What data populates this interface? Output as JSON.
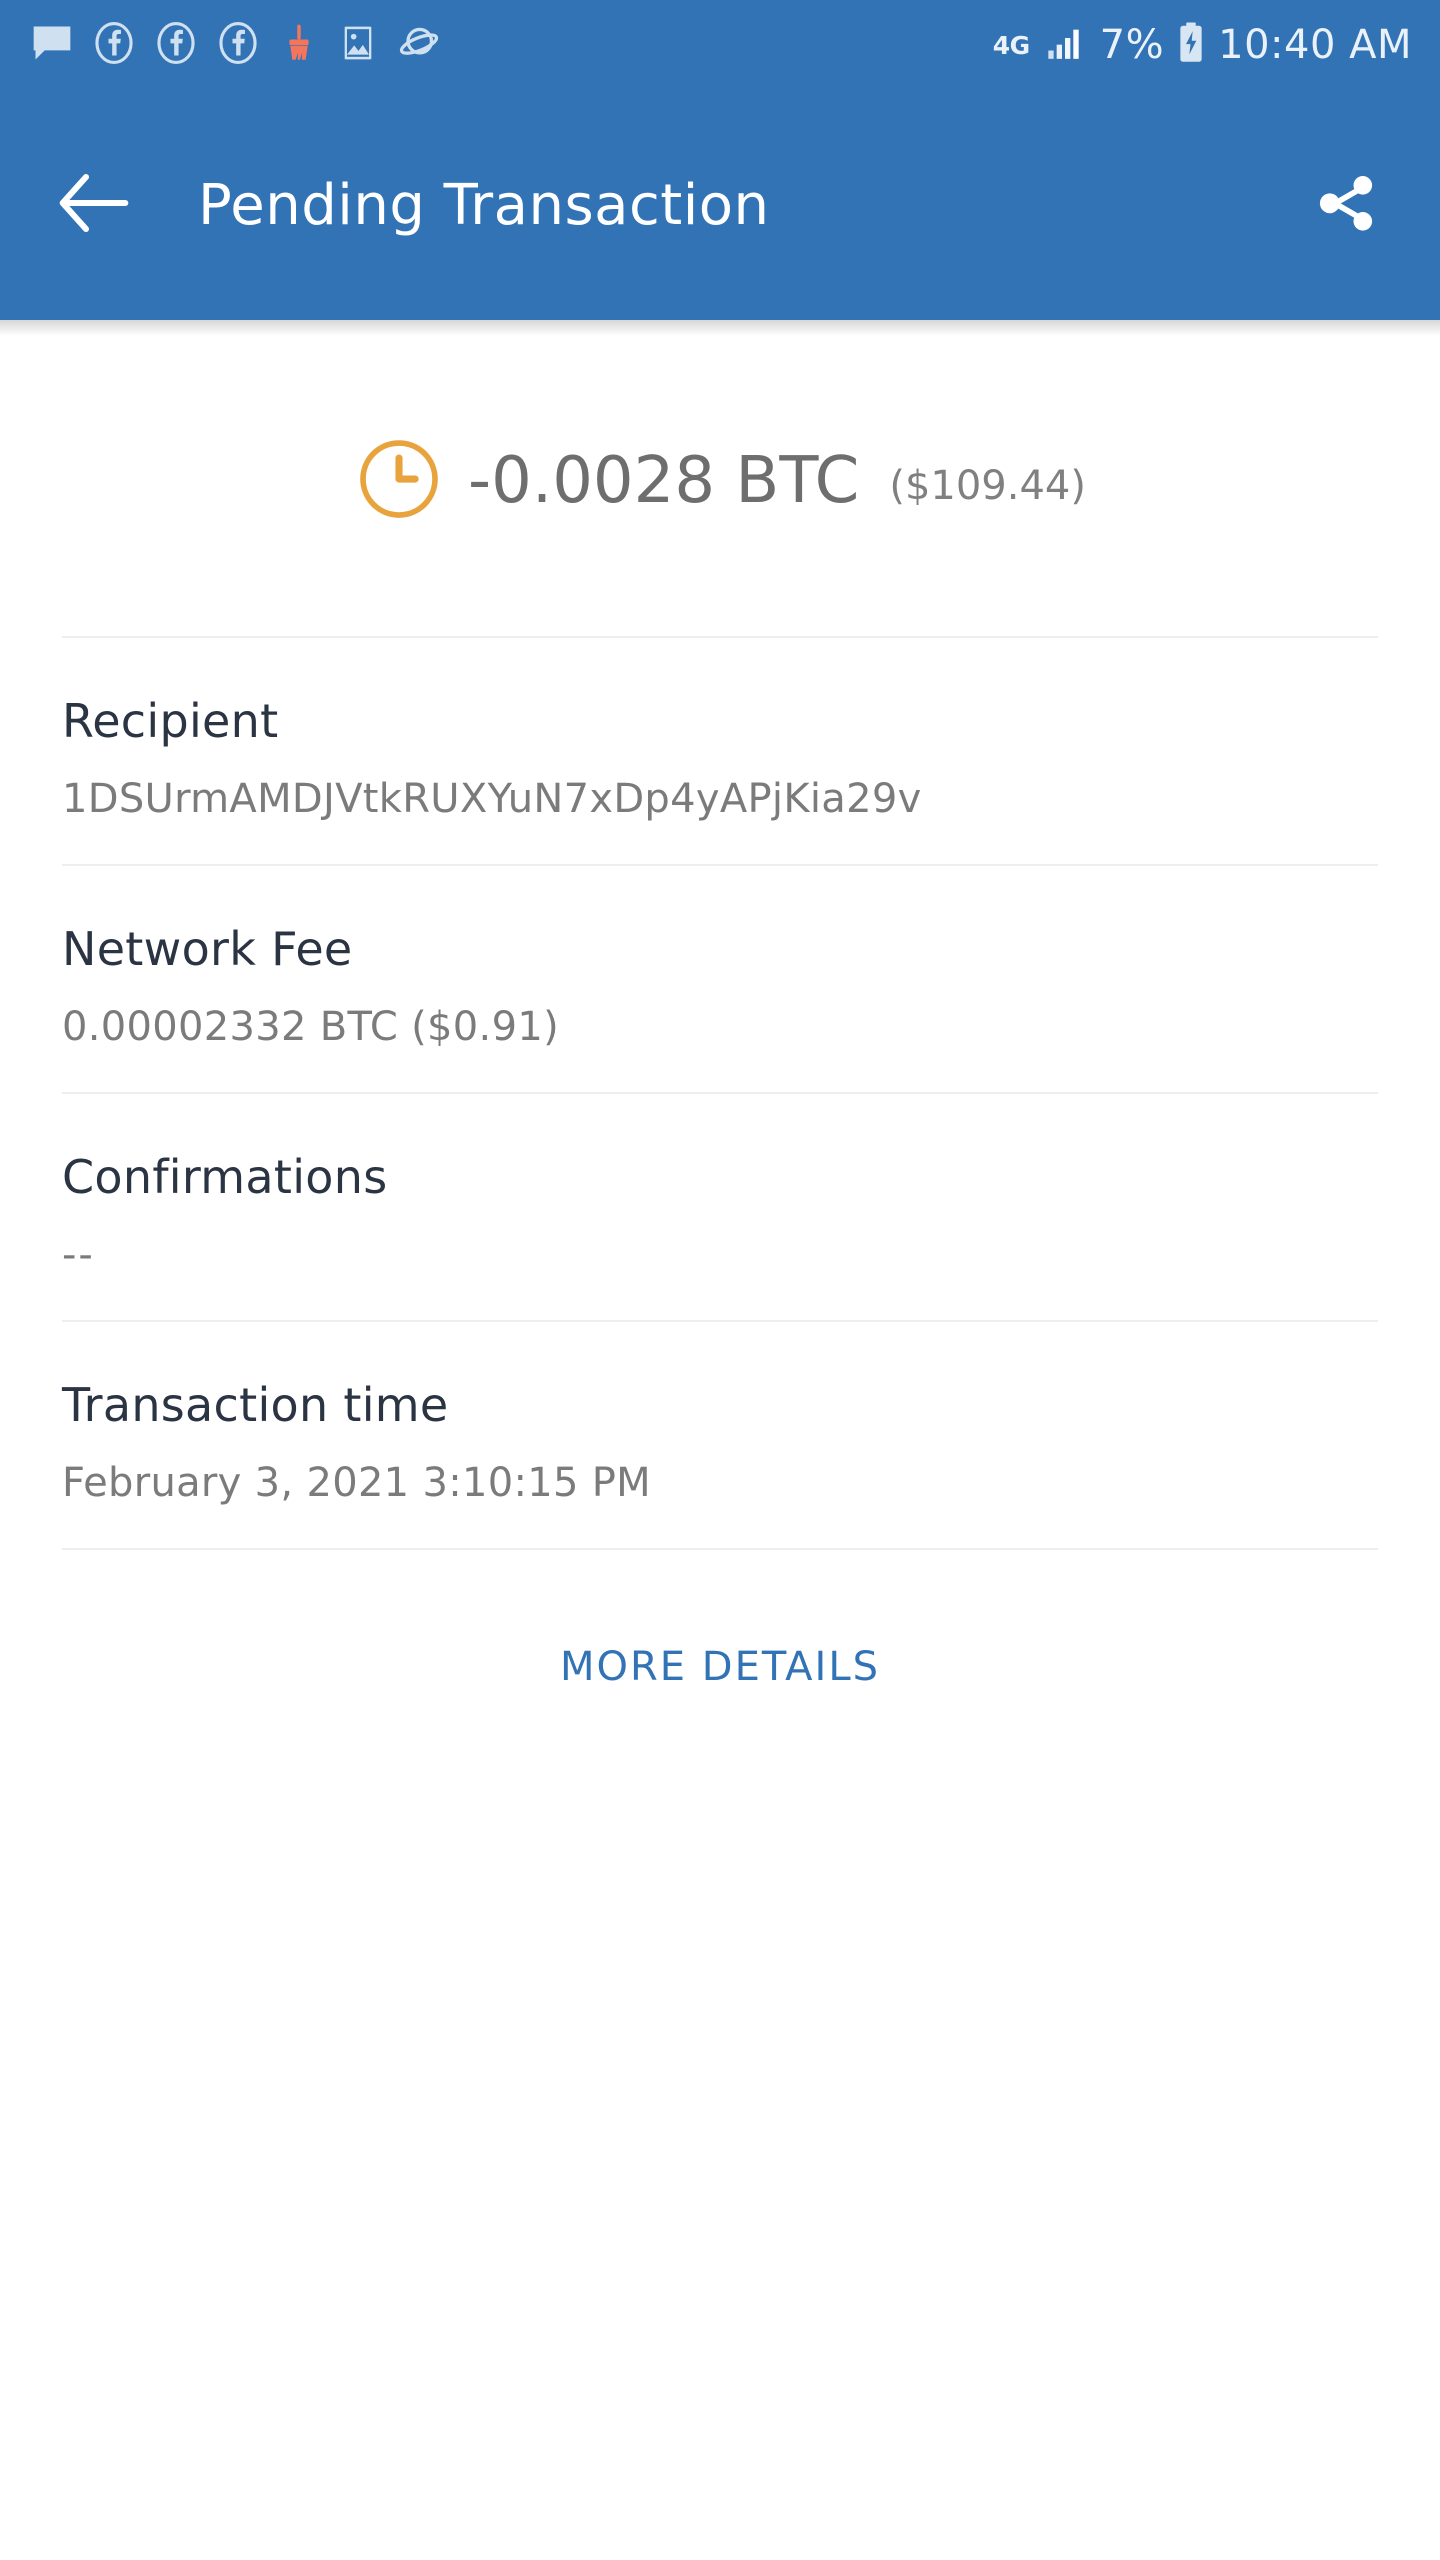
{
  "status_bar": {
    "notification_icons": [
      {
        "name": "message-icon",
        "label": "message"
      },
      {
        "name": "facebook-icon-1",
        "label": "facebook"
      },
      {
        "name": "facebook-icon-2",
        "label": "facebook"
      },
      {
        "name": "facebook-icon-3",
        "label": "facebook"
      },
      {
        "name": "broom-cleaner-icon",
        "label": "cleaner"
      },
      {
        "name": "photo-image-icon",
        "label": "image"
      },
      {
        "name": "planet-browser-icon",
        "label": "browser"
      }
    ],
    "network_type": "4G",
    "signal_icon": "signal-bars-icon",
    "battery_percent": "7%",
    "battery_icon": "battery-charging-icon",
    "clock": "10:40 AM"
  },
  "app_bar": {
    "back_icon": "arrow-left-icon",
    "title": "Pending Transaction",
    "share_icon": "share-icon"
  },
  "transaction": {
    "status_icon": "clock-pending-icon",
    "amount": "-0.0028 BTC",
    "fiat_amount": "($109.44)",
    "rows": [
      {
        "label": "Recipient",
        "value": "1DSUrmAMDJVtkRUXYuN7xDp4yAPjKia29v"
      },
      {
        "label": "Network Fee",
        "value": "0.00002332 BTC ($0.91)"
      },
      {
        "label": "Confirmations",
        "value": "--"
      },
      {
        "label": "Transaction time",
        "value": "February 3, 2021 3:10:15 PM"
      }
    ],
    "more_details_label": "MORE DETAILS"
  },
  "colors": {
    "header_blue": "#3273b6",
    "pending_orange": "#e8a33d",
    "link_blue": "#3273b6",
    "label_dark": "#2b3443",
    "value_gray": "#7b7b7b"
  }
}
